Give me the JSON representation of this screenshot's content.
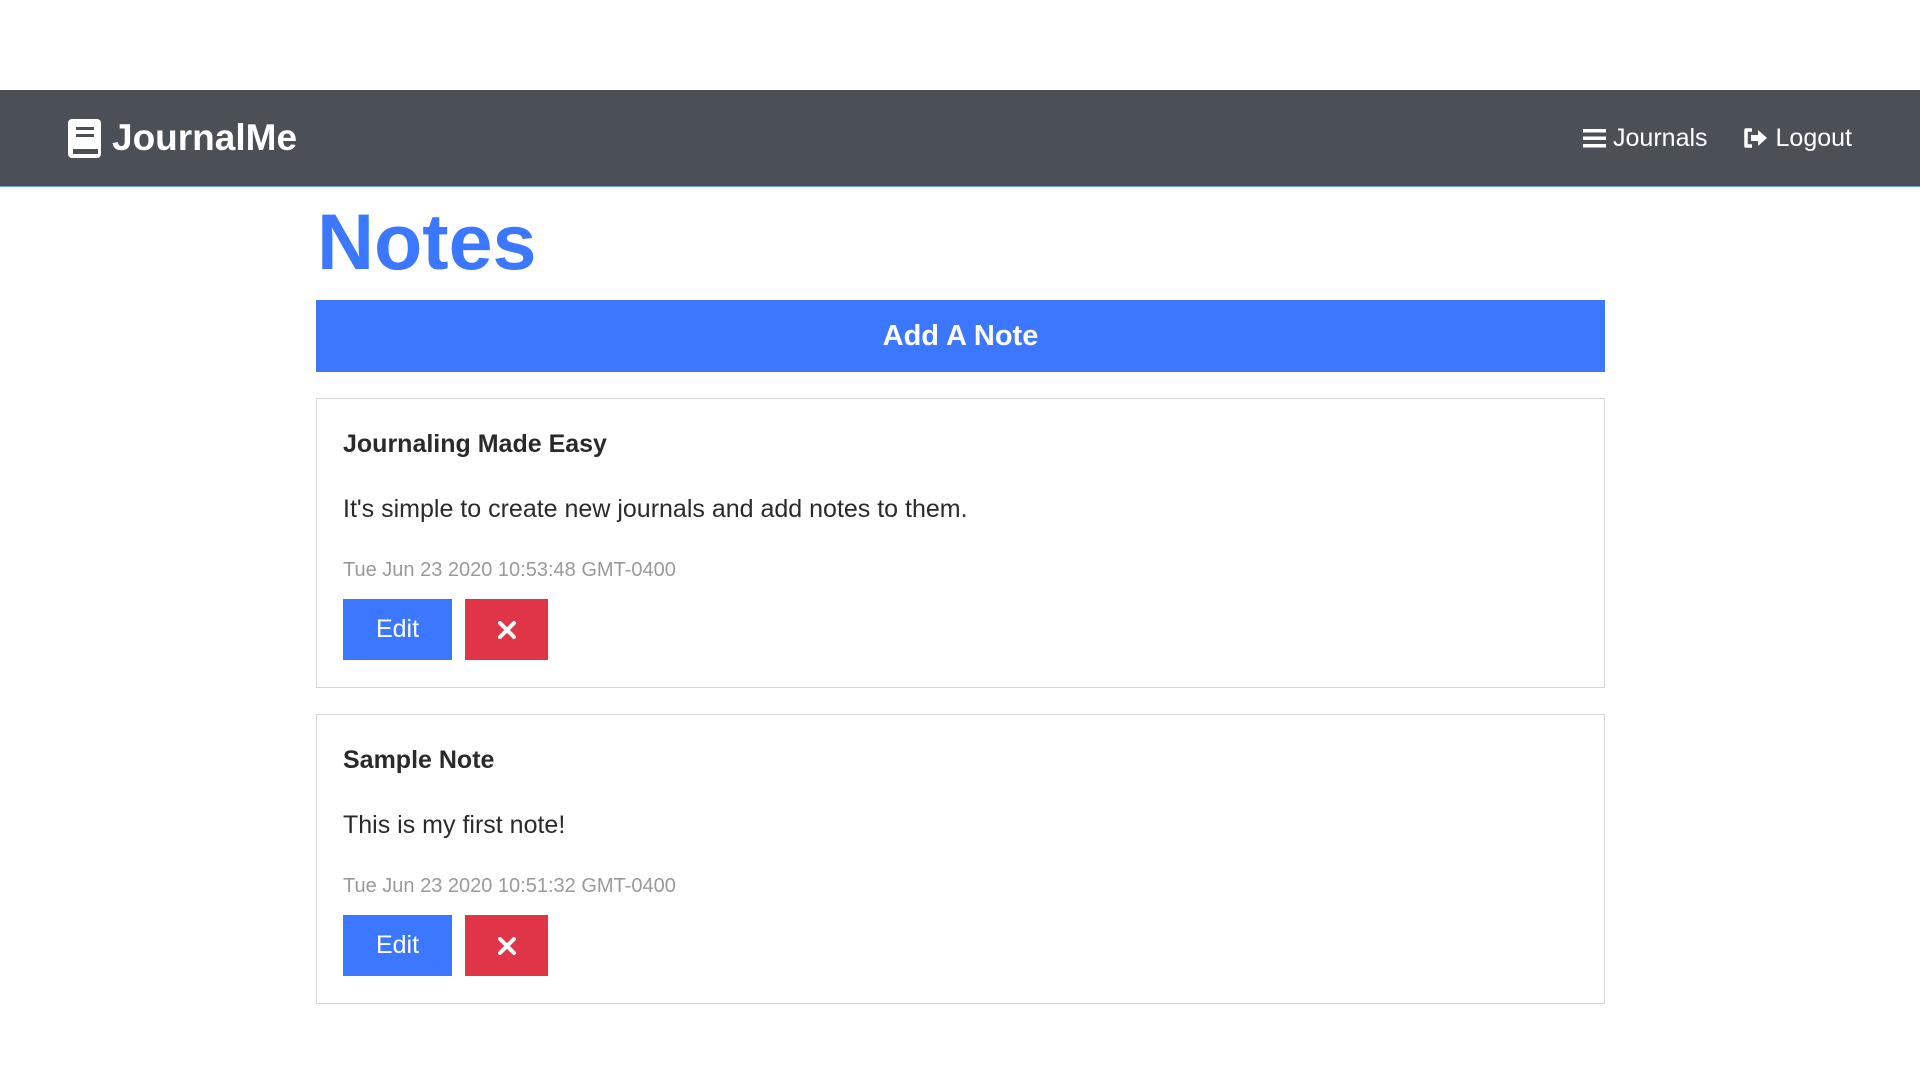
{
  "app": {
    "brand": "JournalMe"
  },
  "nav": {
    "journals_label": "Journals",
    "logout_label": "Logout"
  },
  "page": {
    "title": "Notes",
    "add_note_label": "Add A Note"
  },
  "notes": [
    {
      "title": "Journaling Made Easy",
      "body": "It's simple to create new journals and add notes to them.",
      "date": "Tue Jun 23 2020 10:53:48 GMT-0400",
      "edit_label": "Edit"
    },
    {
      "title": "Sample Note",
      "body": "This is my first note!",
      "date": "Tue Jun 23 2020 10:51:32 GMT-0400",
      "edit_label": "Edit"
    }
  ],
  "colors": {
    "navbar": "#4b4f56",
    "primary": "#3b78ff",
    "danger": "#e03546",
    "muted_text": "#9a9a9a"
  },
  "icons": {
    "brand": "book-icon",
    "journals": "bars-icon",
    "logout": "sign-out-icon",
    "delete": "times-icon"
  }
}
